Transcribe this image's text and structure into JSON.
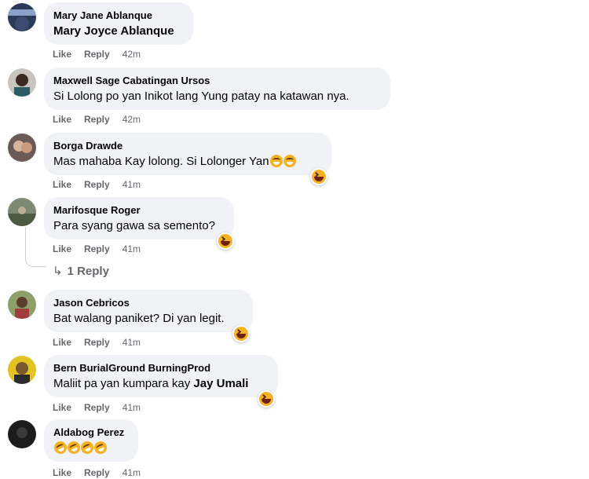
{
  "comments": [
    {
      "author": "Mary Jane Ablanque",
      "text": "",
      "mention": "Mary Joyce Ablanque",
      "like": "Like",
      "reply": "Reply",
      "time": "42m"
    },
    {
      "author": "Maxwell Sage Cabatingan Ursos",
      "text": "Si Lolong po yan Inikot lang Yung patay na katawan nya.",
      "like": "Like",
      "reply": "Reply",
      "time": "42m"
    },
    {
      "author": "Borga Drawde",
      "text": "Mas mahaba Kay lolong. Si Lolonger Yan",
      "inline_emoji": [
        "grin-emoji",
        "grin-emoji"
      ],
      "like": "Like",
      "reply": "Reply",
      "time": "41m",
      "reaction": "haha"
    },
    {
      "author": "Marifosque Roger",
      "text": "Para syang gawa sa semento?",
      "like": "Like",
      "reply": "Reply",
      "time": "41m",
      "reaction": "haha",
      "reply_count": "1 Reply"
    },
    {
      "author": "Jason Cebricos",
      "text": "Bat walang paniket? Di yan legit.",
      "like": "Like",
      "reply": "Reply",
      "time": "41m",
      "reaction": "haha"
    },
    {
      "author": "Bern BurialGround BurningProd",
      "text": "Maliit pa yan kumpara kay ",
      "mention": "Jay Umali",
      "like": "Like",
      "reply": "Reply",
      "time": "41m",
      "reaction": "haha"
    },
    {
      "author": "Aldabog Perez",
      "text": "",
      "inline_emoji": [
        "rofl-emoji",
        "rofl-emoji",
        "rofl-emoji",
        "rofl-emoji"
      ],
      "like": "Like",
      "reply": "Reply",
      "time": "41m"
    }
  ],
  "colors": {
    "bubble": "#f0f2f5",
    "meta": "#65676b",
    "reaction": "#f7b125"
  }
}
